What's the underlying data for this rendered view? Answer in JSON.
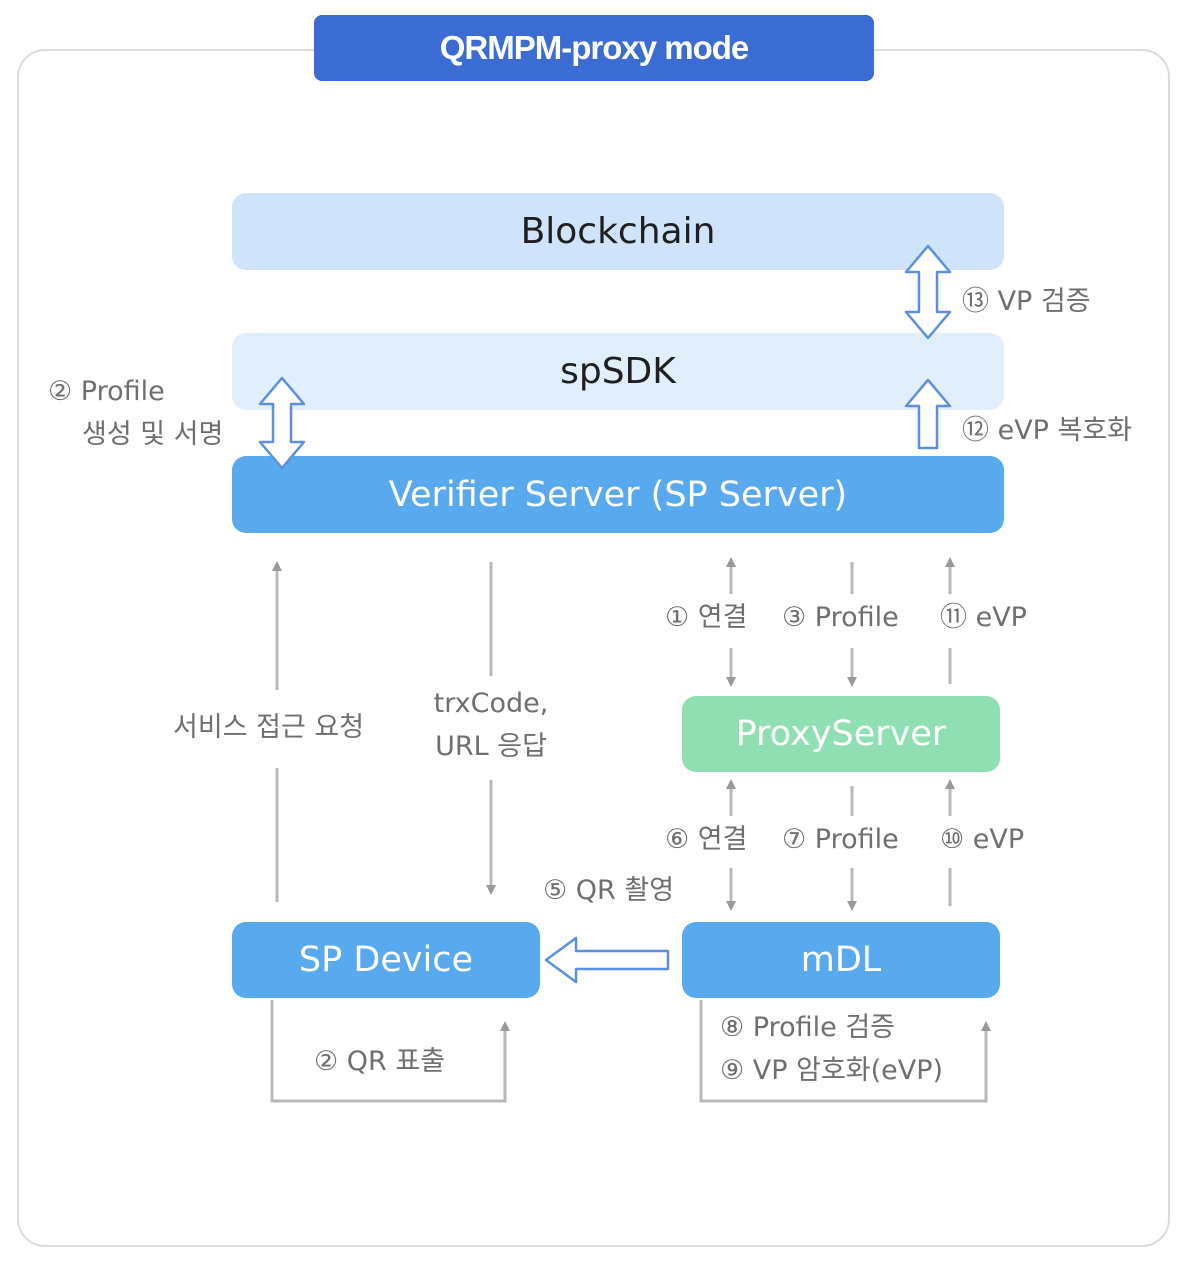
{
  "title": "QRMPM-proxy mode",
  "boxes": {
    "blockchain": "Blockchain",
    "spsdk": "spSDK",
    "verifier": "Verifier Server (SP Server)",
    "proxy": "ProxyServer",
    "sp_device": "SP Device",
    "mdl": "mDL"
  },
  "labels": {
    "vp_verify": "⑬ VP 검증",
    "evp_decrypt": "⑫ eVP 복호화",
    "profile_sign_1": "② Profile",
    "profile_sign_2": "생성 및 서명",
    "connect_1": "① 연결",
    "profile_3": "③ Profile",
    "evp_11": "⑪ eVP",
    "service_request": "서비스 접근 요청",
    "trx_1": "trxCode,",
    "trx_2": "URL 응답",
    "connect_6": "⑥ 연결",
    "profile_7": "⑦ Profile",
    "evp_10": "⑩ eVP",
    "qr_scan": "⑤ QR 촬영",
    "qr_display": "② QR 표출",
    "profile_verify": "⑧ Profile 검증",
    "vp_encrypt": "⑨ VP 암호화(eVP)"
  }
}
